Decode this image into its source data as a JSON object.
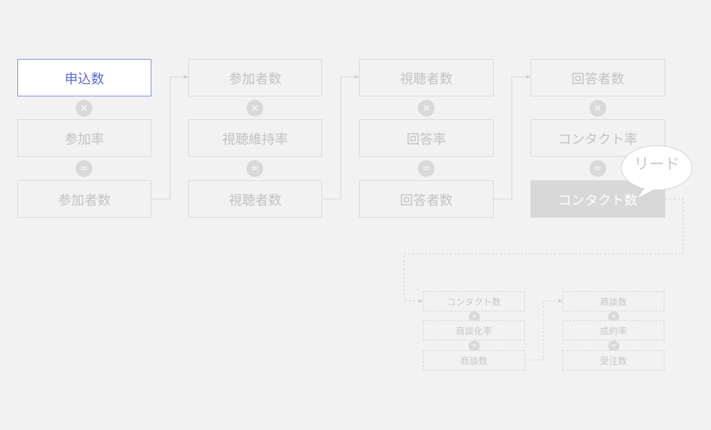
{
  "stage_columns": [
    {
      "top": "申込数",
      "op1_icon": "times-icon",
      "middle": "参加率",
      "op2_icon": "equals-icon",
      "bottom": "参加者数"
    },
    {
      "top": "参加者数",
      "op1_icon": "times-icon",
      "middle": "視聴維持率",
      "op2_icon": "equals-icon",
      "bottom": "視聴者数"
    },
    {
      "top": "視聴者数",
      "op1_icon": "times-icon",
      "middle": "回答率",
      "op2_icon": "equals-icon",
      "bottom": "回答者数"
    },
    {
      "top": "回答者数",
      "op1_icon": "times-icon",
      "middle": "コンタクト率",
      "op2_icon": "equals-icon",
      "bottom": "コンタクト数"
    }
  ],
  "callout": {
    "label": "リード"
  },
  "sales_columns": [
    {
      "top": "コンタクト数",
      "middle": "商談化率",
      "bottom": "商談数"
    },
    {
      "top": "商談数",
      "middle": "成約率",
      "bottom": "受注数"
    }
  ],
  "operators": {
    "multiply": "×",
    "equals": "="
  },
  "colors": {
    "background": "#f2f2f2",
    "active_border": "#7f8de0",
    "active_text": "#5b6bd6",
    "highlight_fill": "#d8d8d8",
    "muted_text": "#c2c2c2"
  }
}
